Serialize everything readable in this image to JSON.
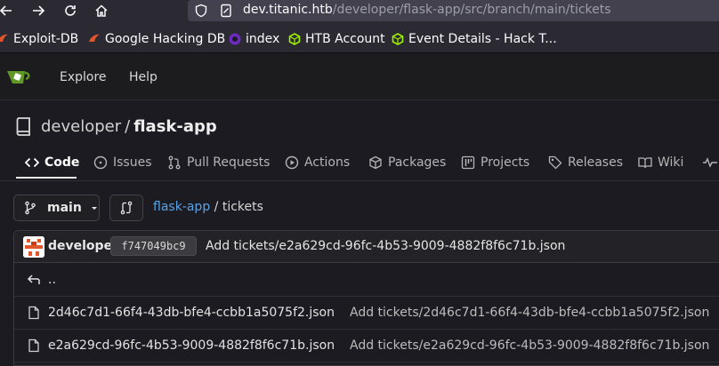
{
  "browser": {
    "url_host": "dev.titanic.htb",
    "url_path": "/developer/flask-app/src/branch/main/tickets",
    "bookmarks": [
      {
        "label": "Exploit-DB",
        "icon": "exploit-db-icon"
      },
      {
        "label": "Google Hacking DB",
        "icon": "ghdb-icon"
      },
      {
        "label": "index",
        "icon": "index-icon"
      },
      {
        "label": "HTB Account",
        "icon": "htb-icon"
      },
      {
        "label": "Event Details - Hack T...",
        "icon": "htb-icon"
      }
    ]
  },
  "nav": {
    "explore": "Explore",
    "help": "Help"
  },
  "repo": {
    "owner": "developer",
    "separator": "/",
    "name": "flask-app"
  },
  "tabs": [
    {
      "label": "Code",
      "icon": "code-icon",
      "active": true
    },
    {
      "label": "Issues",
      "icon": "issues-icon"
    },
    {
      "label": "Pull Requests",
      "icon": "pull-request-icon"
    },
    {
      "label": "Actions",
      "icon": "play-icon"
    },
    {
      "label": "Packages",
      "icon": "package-icon"
    },
    {
      "label": "Projects",
      "icon": "project-icon"
    },
    {
      "label": "Releases",
      "icon": "tag-icon"
    },
    {
      "label": "Wiki",
      "icon": "book-icon"
    }
  ],
  "branch": {
    "name": "main"
  },
  "breadcrumb": {
    "root": "flask-app",
    "separator": "/",
    "current": "tickets"
  },
  "latest_commit": {
    "author": "developer",
    "sha": "f747049bc9",
    "message": "Add tickets/e2a629cd-96fc-4b53-9009-4882f8f6c71b.json"
  },
  "parent_dir": "..",
  "files": [
    {
      "name": "2d46c7d1-66f4-43db-bfe4-ccbb1a5075f2.json",
      "message": "Add tickets/2d46c7d1-66f4-43db-bfe4-ccbb1a5075f2.json"
    },
    {
      "name": "e2a629cd-96fc-4b53-9009-4882f8f6c71b.json",
      "message": "Add tickets/e2a629cd-96fc-4b53-9009-4882f8f6c71b.json"
    }
  ],
  "colors": {
    "link": "#5aa2e6",
    "gitea_green": "#609926",
    "htb_green": "#9fef00"
  }
}
